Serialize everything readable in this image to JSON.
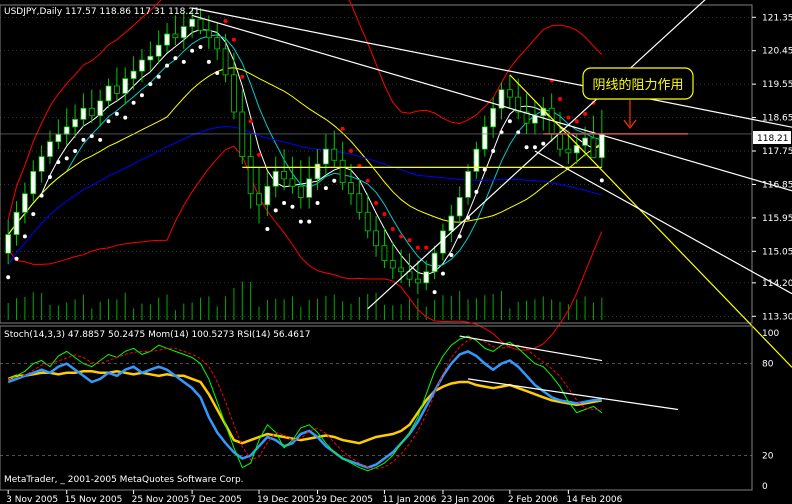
{
  "chart_header": {
    "symbol_line": "USDJPY,Daily  117.57 118.86 117.31 118.21",
    "indicator_line": "Stoch(14,3,3) 47.8857 50.2475  Mom(14) 100.5273  RSI(14) 56.4617",
    "copyright": "MetaTrader, _ 2001-2005 MetaQuotes Software Corp.",
    "annotation": "阴线的阻力作用",
    "current_price": "118.21"
  },
  "colors": {
    "background": "#000000",
    "bull_candle": "#ffffff",
    "bear_candle": "#000000",
    "candle_edge": "#00cc00",
    "grid": "#808080",
    "bollinger": "#ff0000",
    "ma_fast": "#ffffff",
    "ma_mid": "#ffff00",
    "ma_slow": "#0000ff",
    "ma_cyan": "#00cccc",
    "sar": "#ff0000",
    "annotation_border": "#ffff00",
    "stoch_main": "#00ff00",
    "stoch_signal": "#ff0000",
    "momentum": "#ffcc00",
    "rsi": "#3399ff",
    "volume": "#00aa00"
  },
  "chart_data": [
    {
      "type": "candlestick",
      "title": "USDJPY,Daily",
      "ylim": [
        113.2,
        121.6
      ],
      "y_ticks": [
        "121.35",
        "120.45",
        "119.55",
        "118.65",
        "117.75",
        "116.85",
        "115.95",
        "115.05",
        "114.20",
        "113.30"
      ],
      "x_ticks": [
        "3 Nov 2005",
        "15 Nov 2005",
        "25 Nov 2005",
        "7 Dec 2005",
        "19 Dec 2005",
        "29 Dec 2005",
        "11 Jan 2006",
        "23 Jan 2006",
        "2 Feb 2006",
        "14 Feb 2006"
      ],
      "support_line": 117.31,
      "resistance_line": 118.21,
      "series": [
        {
          "name": "OHLC",
          "open": [
            115.0,
            115.5,
            116.1,
            116.6,
            117.2,
            117.6,
            118.0,
            118.2,
            118.4,
            118.6,
            118.9,
            118.7,
            119.1,
            119.5,
            119.3,
            119.7,
            119.9,
            120.2,
            120.3,
            120.6,
            120.9,
            120.8,
            121.1,
            121.3,
            121.0,
            120.8,
            120.5,
            119.8,
            118.8,
            117.6,
            116.6,
            116.3,
            116.8,
            117.2,
            117.0,
            116.8,
            116.5,
            117.0,
            117.4,
            117.8,
            117.5,
            116.9,
            116.6,
            116.1,
            115.6,
            115.2,
            114.8,
            114.6,
            114.5,
            114.3,
            114.2,
            114.5,
            115.0,
            115.6,
            116.0,
            116.5,
            117.2,
            117.8,
            118.4,
            118.9,
            119.4,
            119.2,
            118.8,
            118.5,
            118.7,
            118.9,
            118.2,
            117.8,
            117.7,
            117.9,
            118.1,
            117.57
          ],
          "high": [
            115.9,
            116.4,
            116.9,
            117.5,
            117.9,
            118.3,
            118.6,
            118.9,
            119.0,
            119.3,
            119.4,
            119.4,
            119.7,
            120.0,
            120.0,
            120.3,
            120.5,
            120.7,
            121.0,
            121.2,
            121.4,
            121.5,
            121.6,
            121.6,
            121.4,
            121.2,
            120.9,
            120.4,
            119.4,
            118.2,
            117.3,
            117.2,
            117.6,
            117.8,
            117.6,
            117.5,
            117.6,
            117.8,
            118.2,
            118.3,
            118.0,
            117.4,
            117.0,
            116.6,
            116.0,
            115.7,
            115.3,
            115.1,
            115.0,
            114.8,
            114.8,
            115.2,
            115.8,
            116.3,
            116.8,
            117.4,
            118.0,
            118.7,
            119.2,
            119.6,
            119.8,
            119.7,
            119.3,
            119.1,
            119.2,
            119.3,
            118.8,
            118.3,
            118.2,
            118.4,
            118.7,
            118.86
          ],
          "low": [
            114.7,
            115.2,
            115.8,
            116.4,
            116.9,
            117.4,
            117.8,
            117.9,
            118.1,
            118.4,
            118.5,
            118.4,
            118.9,
            119.1,
            119.0,
            119.4,
            119.6,
            119.9,
            120.1,
            120.4,
            120.6,
            120.5,
            120.8,
            120.9,
            120.5,
            120.2,
            119.6,
            118.6,
            117.4,
            116.2,
            115.8,
            116.0,
            116.5,
            116.7,
            116.6,
            116.2,
            116.2,
            116.7,
            117.1,
            117.3,
            116.7,
            116.3,
            115.9,
            115.4,
            114.9,
            114.6,
            114.3,
            114.2,
            114.1,
            113.9,
            114.0,
            114.3,
            114.8,
            115.3,
            115.8,
            116.3,
            117.0,
            117.6,
            118.1,
            118.6,
            118.9,
            118.6,
            118.2,
            118.2,
            118.3,
            118.0,
            117.6,
            117.4,
            117.4,
            117.6,
            117.8,
            117.31
          ],
          "close": [
            115.5,
            116.1,
            116.6,
            117.2,
            117.6,
            118.0,
            118.2,
            118.4,
            118.6,
            118.9,
            118.7,
            119.1,
            119.5,
            119.3,
            119.7,
            119.9,
            120.2,
            120.3,
            120.6,
            120.9,
            120.8,
            121.1,
            121.3,
            121.0,
            120.8,
            120.5,
            119.8,
            118.8,
            117.6,
            116.6,
            116.3,
            116.8,
            117.2,
            117.0,
            116.8,
            116.5,
            117.0,
            117.4,
            117.8,
            117.5,
            116.9,
            116.6,
            116.1,
            115.6,
            115.2,
            114.8,
            114.6,
            114.5,
            114.3,
            114.2,
            114.5,
            115.0,
            115.6,
            116.0,
            116.5,
            117.2,
            117.8,
            118.4,
            118.9,
            119.4,
            119.2,
            118.8,
            118.5,
            118.7,
            118.9,
            118.2,
            117.8,
            117.7,
            117.9,
            118.1,
            117.57,
            118.21
          ]
        }
      ]
    },
    {
      "type": "line",
      "title": "Stoch(14,3,3) Mom(14) RSI(14)",
      "ylim": [
        0,
        100
      ],
      "y_ticks": [
        "100",
        "80",
        "20",
        "0"
      ],
      "series": [
        {
          "name": "Stoch(14,3,3)",
          "values": [
            70,
            72,
            75,
            80,
            82,
            78,
            85,
            88,
            84,
            80,
            78,
            82,
            86,
            84,
            88,
            90,
            86,
            88,
            92,
            90,
            88,
            86,
            84,
            80,
            70,
            55,
            40,
            25,
            12,
            15,
            30,
            40,
            35,
            25,
            30,
            38,
            40,
            35,
            28,
            22,
            18,
            15,
            12,
            10,
            12,
            15,
            20,
            28,
            35,
            45,
            60,
            75,
            85,
            92,
            96,
            98,
            95,
            90,
            88,
            92,
            94,
            90,
            85,
            80,
            78,
            72,
            65,
            55,
            48,
            50,
            52,
            47.9
          ]
        },
        {
          "name": "Mom(14)",
          "values": [
            70,
            72,
            72,
            73,
            74,
            74,
            73,
            74,
            74,
            75,
            75,
            74,
            74,
            75,
            74,
            73,
            74,
            73,
            72,
            73,
            72,
            72,
            70,
            68,
            60,
            50,
            40,
            30,
            28,
            30,
            32,
            34,
            33,
            32,
            31,
            30,
            31,
            32,
            33,
            32,
            30,
            29,
            28,
            30,
            32,
            33,
            34,
            36,
            40,
            48,
            56,
            62,
            65,
            67,
            68,
            68,
            66,
            65,
            64,
            65,
            66,
            64,
            62,
            60,
            58,
            56,
            55,
            54,
            53,
            54,
            55,
            56
          ]
        },
        {
          "name": "RSI(14)",
          "values": [
            68,
            70,
            72,
            74,
            76,
            74,
            78,
            80,
            76,
            72,
            68,
            70,
            74,
            72,
            76,
            78,
            74,
            76,
            78,
            76,
            72,
            68,
            64,
            58,
            45,
            35,
            28,
            22,
            18,
            20,
            26,
            32,
            30,
            26,
            28,
            34,
            36,
            32,
            26,
            22,
            18,
            16,
            14,
            12,
            14,
            18,
            22,
            28,
            34,
            42,
            52,
            62,
            72,
            80,
            86,
            88,
            85,
            80,
            76,
            80,
            82,
            78,
            72,
            66,
            62,
            58,
            56,
            55,
            54,
            55,
            56,
            56.5
          ]
        }
      ]
    }
  ]
}
